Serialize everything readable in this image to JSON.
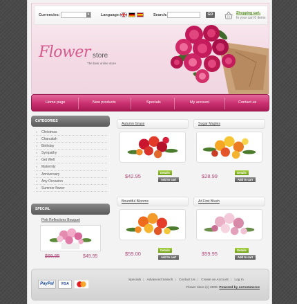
{
  "topbar": {
    "currencies_label": "Currencies:",
    "language_label": "Language:",
    "search_label": "Search:",
    "go_label": "GO",
    "cart_title": "Shopping cart:",
    "cart_text": "In your cart 0 items"
  },
  "logo": {
    "flower": "Flower",
    "store": "store",
    "tagline": "The best online store"
  },
  "nav": {
    "items": [
      "Home page",
      "New products",
      "Specials",
      "My account",
      "Contact us"
    ]
  },
  "categories": {
    "heading": "CATEGORIES",
    "items": [
      "Christmas",
      "Chanukah",
      "Birthday",
      "Sympathy",
      "Get Well",
      "Maternity",
      "Anniversary",
      "Any Occasion",
      "Summer flower"
    ]
  },
  "special": {
    "heading": "SPECIAL",
    "title": "Pink Reflections Bouquet",
    "old_price": "$69.95",
    "new_price": "$49.95"
  },
  "products": [
    {
      "title": "Autumn Grace",
      "price": "$42.95",
      "details": "Details",
      "add": "Add to cart"
    },
    {
      "title": "Sugar Maples",
      "price": "$28.99",
      "details": "Details",
      "add": "Add to cart"
    },
    {
      "title": "Bountiful Blooms",
      "price": "$59.00",
      "details": "Details",
      "add": "Add to cart"
    },
    {
      "title": "At First Blush",
      "price": "$59.95",
      "details": "Details",
      "add": "Add to cart"
    }
  ],
  "footer": {
    "links": [
      "Specials",
      "Advanced Search",
      "Contact Us",
      "Create an Account",
      "Log In"
    ],
    "copyright": "Flower store (c) 2009.",
    "powered": "Powered by osCommerce",
    "payment": {
      "paypal": "PayPal",
      "visa": "VISA"
    }
  },
  "colors": {
    "accent": "#c92f6f",
    "price": "#b04a7a",
    "details_button": "#8ab828",
    "heading_gray": "#6e6e6e"
  }
}
